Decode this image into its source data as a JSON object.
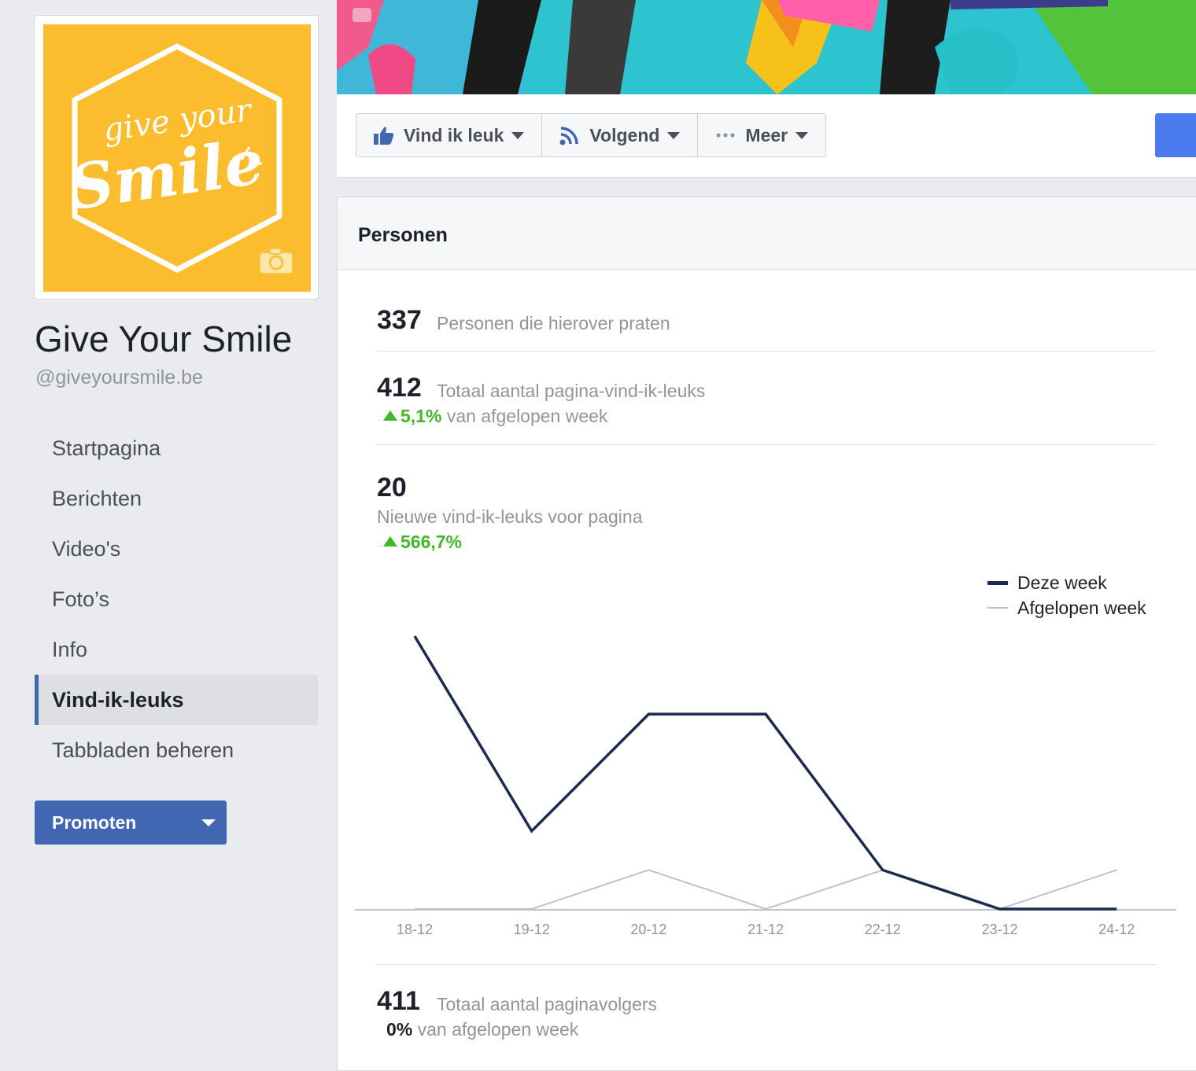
{
  "page": {
    "name": "Give Your Smile",
    "handle": "@giveyoursmile.be",
    "logo_text_top": "give your",
    "logo_text_main": "Smile"
  },
  "nav": {
    "items": [
      {
        "label": "Startpagina",
        "active": false
      },
      {
        "label": "Berichten",
        "active": false
      },
      {
        "label": "Video's",
        "active": false
      },
      {
        "label": "Foto’s",
        "active": false
      },
      {
        "label": "Info",
        "active": false
      },
      {
        "label": "Vind-ik-leuks",
        "active": true
      },
      {
        "label": "Tabbladen beheren",
        "active": false
      }
    ]
  },
  "promote": {
    "label": "Promoten"
  },
  "actions": {
    "like": "Vind ik leuk",
    "follow": "Volgend",
    "more": "Meer"
  },
  "insights": {
    "title": "Personen",
    "talking": {
      "value": "337",
      "label": "Personen die hierover praten"
    },
    "total_likes": {
      "value": "412",
      "label": "Totaal aantal pagina-vind-ik-leuks",
      "change": "5,1%",
      "change_suffix": "van afgelopen week"
    },
    "new_likes": {
      "value": "20",
      "label": "Nieuwe vind-ik-leuks voor pagina",
      "change": "566,7%"
    },
    "followers": {
      "value": "411",
      "label": "Totaal aantal paginavolgers",
      "change": "0%",
      "change_suffix": "van afgelopen week"
    }
  },
  "colors": {
    "brand": "#4267b2",
    "logo_bg": "#fbbd2e",
    "positive": "#42b72a",
    "series_this_week": "#1c2951",
    "series_last_week": "#bec2c9"
  },
  "chart_data": {
    "type": "line",
    "categories": [
      "18-12",
      "19-12",
      "20-12",
      "21-12",
      "22-12",
      "23-12",
      "24-12"
    ],
    "series": [
      {
        "name": "Deze week",
        "values": [
          7,
          2,
          5,
          5,
          1,
          0,
          0
        ]
      },
      {
        "name": "Afgelopen week",
        "values": [
          0,
          0,
          1,
          0,
          1,
          0,
          1
        ]
      }
    ],
    "ylim": [
      0,
      7
    ],
    "grid": false,
    "legend": "top-right"
  }
}
